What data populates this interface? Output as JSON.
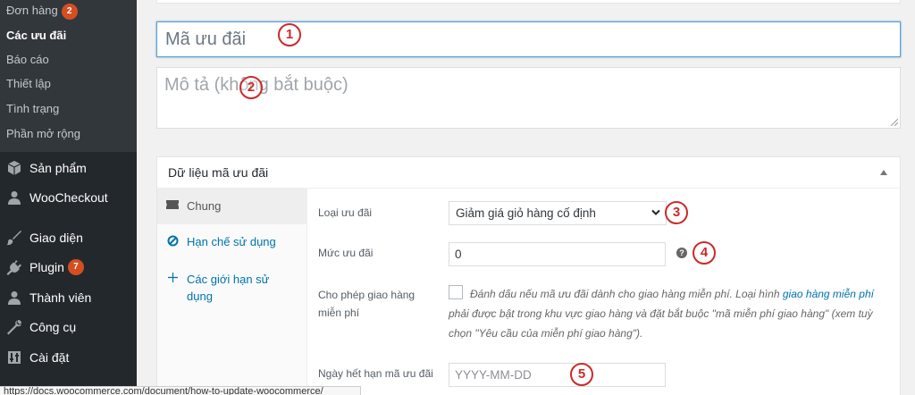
{
  "sidebar": {
    "submenu": [
      {
        "label": "Đơn hàng",
        "badge": "2"
      },
      {
        "label": "Các ưu đãi",
        "current": true
      },
      {
        "label": "Báo cáo"
      },
      {
        "label": "Thiết lập"
      },
      {
        "label": "Tình trạng"
      },
      {
        "label": "Phần mở rộng"
      }
    ],
    "menu": [
      {
        "label": "Sản phẩm",
        "icon": "box-icon"
      },
      {
        "label": "WooCheckout",
        "icon": "user-icon"
      },
      {
        "label": "Giao diện",
        "icon": "brush-icon"
      },
      {
        "label": "Plugin",
        "icon": "plug-icon",
        "badge": "7"
      },
      {
        "label": "Thành viên",
        "icon": "user-icon"
      },
      {
        "label": "Công cụ",
        "icon": "wrench-icon"
      },
      {
        "label": "Cài đặt",
        "icon": "settings-icon"
      }
    ]
  },
  "coupon": {
    "code_placeholder": "Mã ưu đãi",
    "description_placeholder": "Mô tả (không bắt buộc)"
  },
  "panel": {
    "title": "Dữ liệu mã ưu đãi",
    "tabs": [
      {
        "label": "Chung",
        "icon": "ticket-icon",
        "active": true
      },
      {
        "label": "Hạn chế sử dụng",
        "icon": "block-icon"
      },
      {
        "label": "Các giới hạn sử dụng",
        "icon": "plus-icon"
      }
    ],
    "fields": {
      "discount_type_label": "Loại ưu đãi",
      "discount_type_value": "Giảm giá giỏ hàng cố định",
      "amount_label": "Mức ưu đãi",
      "amount_value": "0",
      "help_symbol": "?",
      "free_shipping_label": "Cho phép giao hàng miễn phí",
      "free_shipping_desc_before": "Đánh dấu nếu mã ưu đãi dành cho giao hàng miễn phí. Loại hình ",
      "free_shipping_link": "giao hàng miễn phí",
      "free_shipping_desc_after": " phải được bật trong khu vực giao hàng và đặt bắt buộc \"mã miễn phí giao hàng\" (xem tuỳ chọn \"Yêu cầu của miễn phí giao hàng\").",
      "expiry_label": "Ngày hết hạn mã ưu đãi",
      "expiry_placeholder": "YYYY-MM-DD"
    }
  },
  "annotations": [
    "1",
    "2",
    "3",
    "4",
    "5"
  ],
  "status_bar": {
    "url": "https://docs.woocommerce.com/document/how-to-update-woocommerce/"
  },
  "colors": {
    "sidebar_bg": "#23282d",
    "link": "#0073aa",
    "badge": "#d54e21",
    "annotation": "#cc2a2a"
  }
}
